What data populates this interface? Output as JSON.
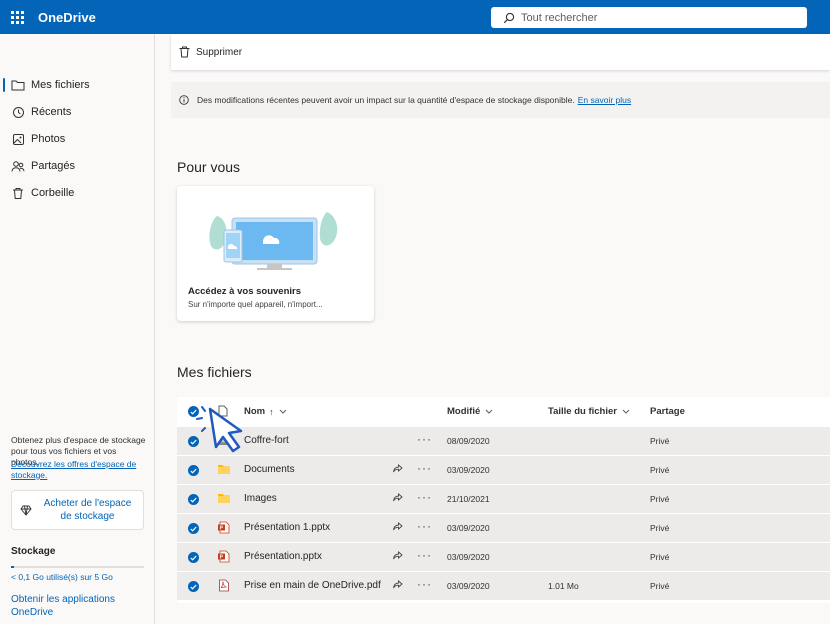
{
  "header": {
    "app_name": "OneDrive",
    "search_placeholder": "Tout rechercher",
    "accent_color": "#0364b8"
  },
  "sidebar": {
    "items": [
      {
        "label": "Mes fichiers",
        "icon": "folder-icon",
        "active": true
      },
      {
        "label": "Récents",
        "icon": "history-icon",
        "active": false
      },
      {
        "label": "Photos",
        "icon": "image-icon",
        "active": false
      },
      {
        "label": "Partagés",
        "icon": "people-icon",
        "active": false
      },
      {
        "label": "Corbeille",
        "icon": "trash-icon",
        "active": false
      }
    ],
    "storage_promo": "Obtenez plus d'espace de stockage pour tous vos fichiers et vos photos.",
    "promo_link": "Découvrez les offres d'espace de stockage.",
    "buy_button": "Acheter de l'espace de stockage",
    "storage_title": "Stockage",
    "storage_usage": "< 0,1 Go utilisé(s) sur 5 Go",
    "storage_fraction": 0.02,
    "get_apps": "Obtenir les applications OneDrive"
  },
  "command_bar": {
    "delete_label": "Supprimer"
  },
  "notice": {
    "text": "Des modifications récentes peuvent avoir un impact sur la quantité d'espace de stockage disponible.",
    "link": "En savoir plus"
  },
  "for_you": {
    "title": "Pour vous",
    "card_title": "Accédez à vos souvenirs",
    "card_subtitle": "Sur n'importe quel appareil, n'import..."
  },
  "files": {
    "title": "Mes fichiers",
    "columns": {
      "name": "Nom",
      "sort_indicator": "↑",
      "modified": "Modifié",
      "size": "Taille du fichier",
      "sharing": "Partage"
    },
    "rows": [
      {
        "name": "Coffre-fort",
        "type": "vault",
        "modified": "08/09/2020",
        "size": "",
        "sharing": "Privé",
        "shareable": false
      },
      {
        "name": "Documents",
        "type": "folder",
        "modified": "03/09/2020",
        "size": "",
        "sharing": "Privé",
        "shareable": true
      },
      {
        "name": "Images",
        "type": "folder",
        "modified": "21/10/2021",
        "size": "",
        "sharing": "Privé",
        "shareable": true
      },
      {
        "name": "Présentation 1.pptx",
        "type": "pptx",
        "modified": "03/09/2020",
        "size": "",
        "sharing": "Privé",
        "shareable": true
      },
      {
        "name": "Présentation.pptx",
        "type": "pptx",
        "modified": "03/09/2020",
        "size": "",
        "sharing": "Privé",
        "shareable": true
      },
      {
        "name": "Prise en main de OneDrive.pdf",
        "type": "pdf",
        "modified": "03/09/2020",
        "size": "1.01 Mo",
        "sharing": "Privé",
        "shareable": true
      }
    ]
  }
}
